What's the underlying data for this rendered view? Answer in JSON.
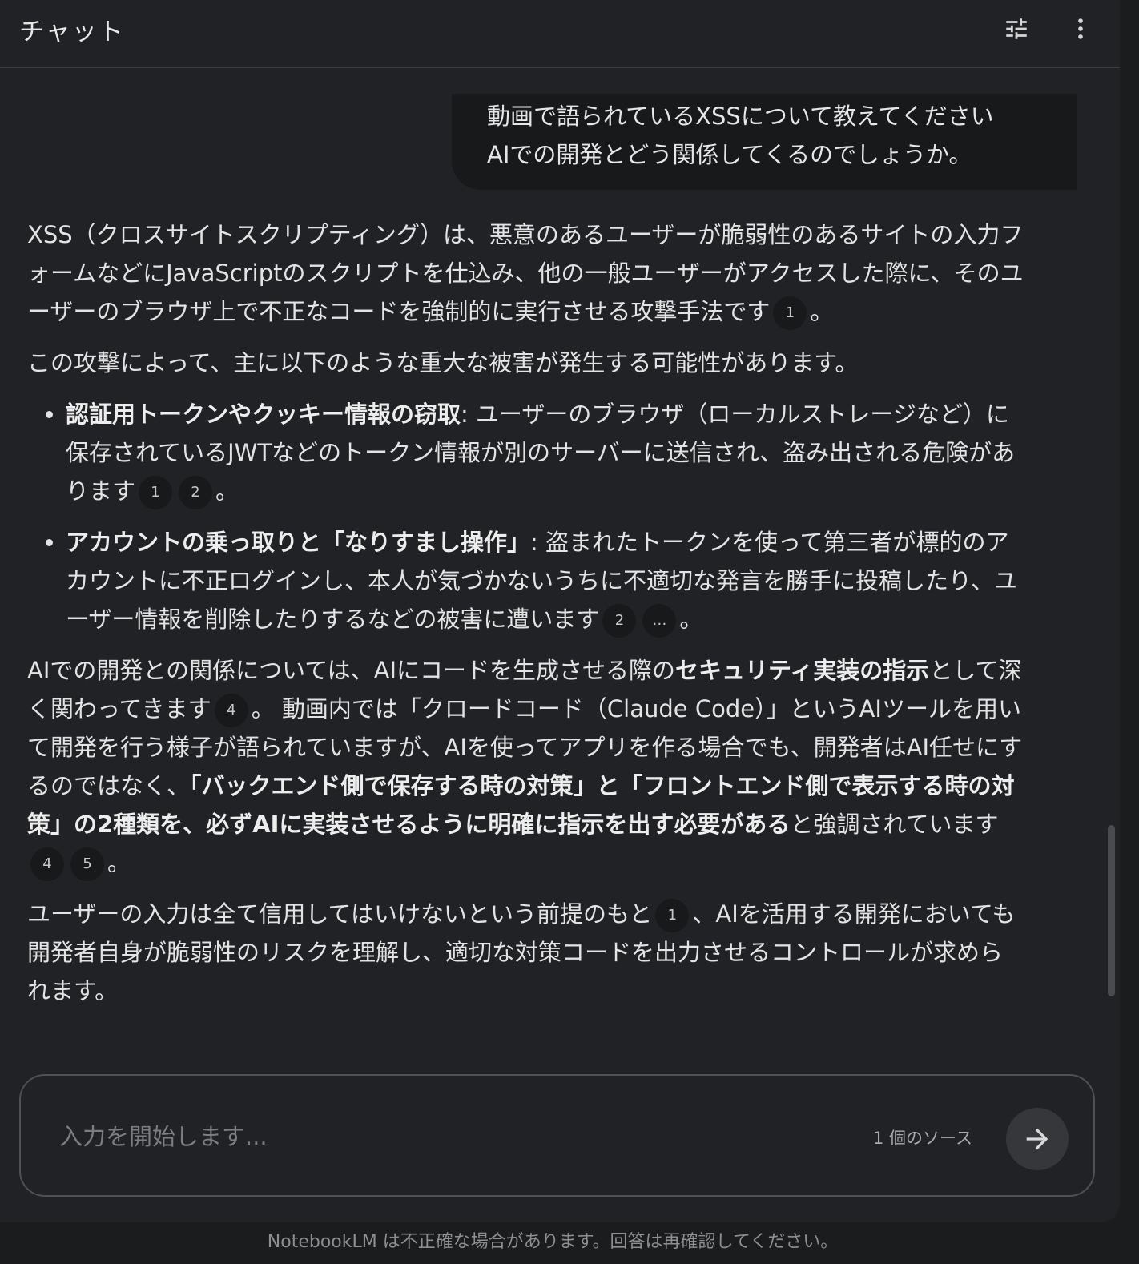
{
  "header": {
    "title": "チャット",
    "settings_icon": "tune-icon",
    "menu_icon": "more-vert-icon"
  },
  "user_message": {
    "line1": "動画で語られているXSSについて教えてください",
    "line2": "AIでの開発とどう関係してくるのでしょうか。"
  },
  "answer": {
    "p1": {
      "text": "XSS（クロスサイトスクリプティング）は、悪意のあるユーザーが脆弱性のあるサイトの入力フォームなどにJavaScriptのスクリプトを仕込み、他の一般ユーザーがアクセスした際に、そのユーザーのブラウザ上で不正なコードを強制的に実行させる攻撃手法です",
      "cite1": "1",
      "end": "。"
    },
    "p2": "この攻撃によって、主に以下のような重大な被害が発生する可能性があります。",
    "bullet1": {
      "bold": "認証用トークンやクッキー情報の窃取",
      "text": ": ユーザーのブラウザ（ローカルストレージなど）に保存されているJWTなどのトークン情報が別のサーバーに送信され、盗み出される危険があります",
      "cite1": "1",
      "cite2": "2",
      "end": "。"
    },
    "bullet2": {
      "bold": "アカウントの乗っ取りと「なりすまし操作」",
      "text": ": 盗まれたトークンを使って第三者が標的のアカウントに不正ログインし、本人が気づかないうちに不適切な発言を勝手に投稿したり、ユーザー情報を削除したりするなどの被害に遭います",
      "cite1": "2",
      "cite2": "…",
      "end": "。"
    },
    "p3": {
      "text1": "AIでの開発との関係については、AIにコードを生成させる際の",
      "bold1": "セキュリティ実装の指示",
      "text2": "として深く関わってきます",
      "cite1": "4",
      "text3": "。 動画内では「クロードコード（Claude Code）」というAIツールを用いて開発を行う様子が語られていますが、AIを使ってアプリを作る場合でも、開発者はAI任せにするのではなく、",
      "bold2": "「バックエンド側で保存する時の対策」と「フロントエンド側で表示する時の対策」の2種類を、必ずAIに実装させるように明確に指示を出す必要がある",
      "text4": "と強調されています",
      "cite2": "4",
      "cite3": "5",
      "end": "。"
    },
    "p4": {
      "text1": "ユーザーの入力は全て信用してはいけないという前提のもと",
      "cite1": "1",
      "text2": "、AIを活用する開発においても開発者自身が脆弱性のリスクを理解し、適切な対策コードを出力させるコントロールが求められます。"
    }
  },
  "composer": {
    "placeholder": "入力を開始します...",
    "value": "",
    "source_count": "1 個のソース",
    "send_icon": "arrow-forward-icon"
  },
  "footer": {
    "disclaimer": "NotebookLM は不正確な場合があります。回答は再確認してください。"
  },
  "colors": {
    "background": "#212225",
    "outer_background": "#1b1c1e",
    "bubble": "#18191b",
    "text": "#e3e3e3",
    "muted": "#8e8f92"
  }
}
